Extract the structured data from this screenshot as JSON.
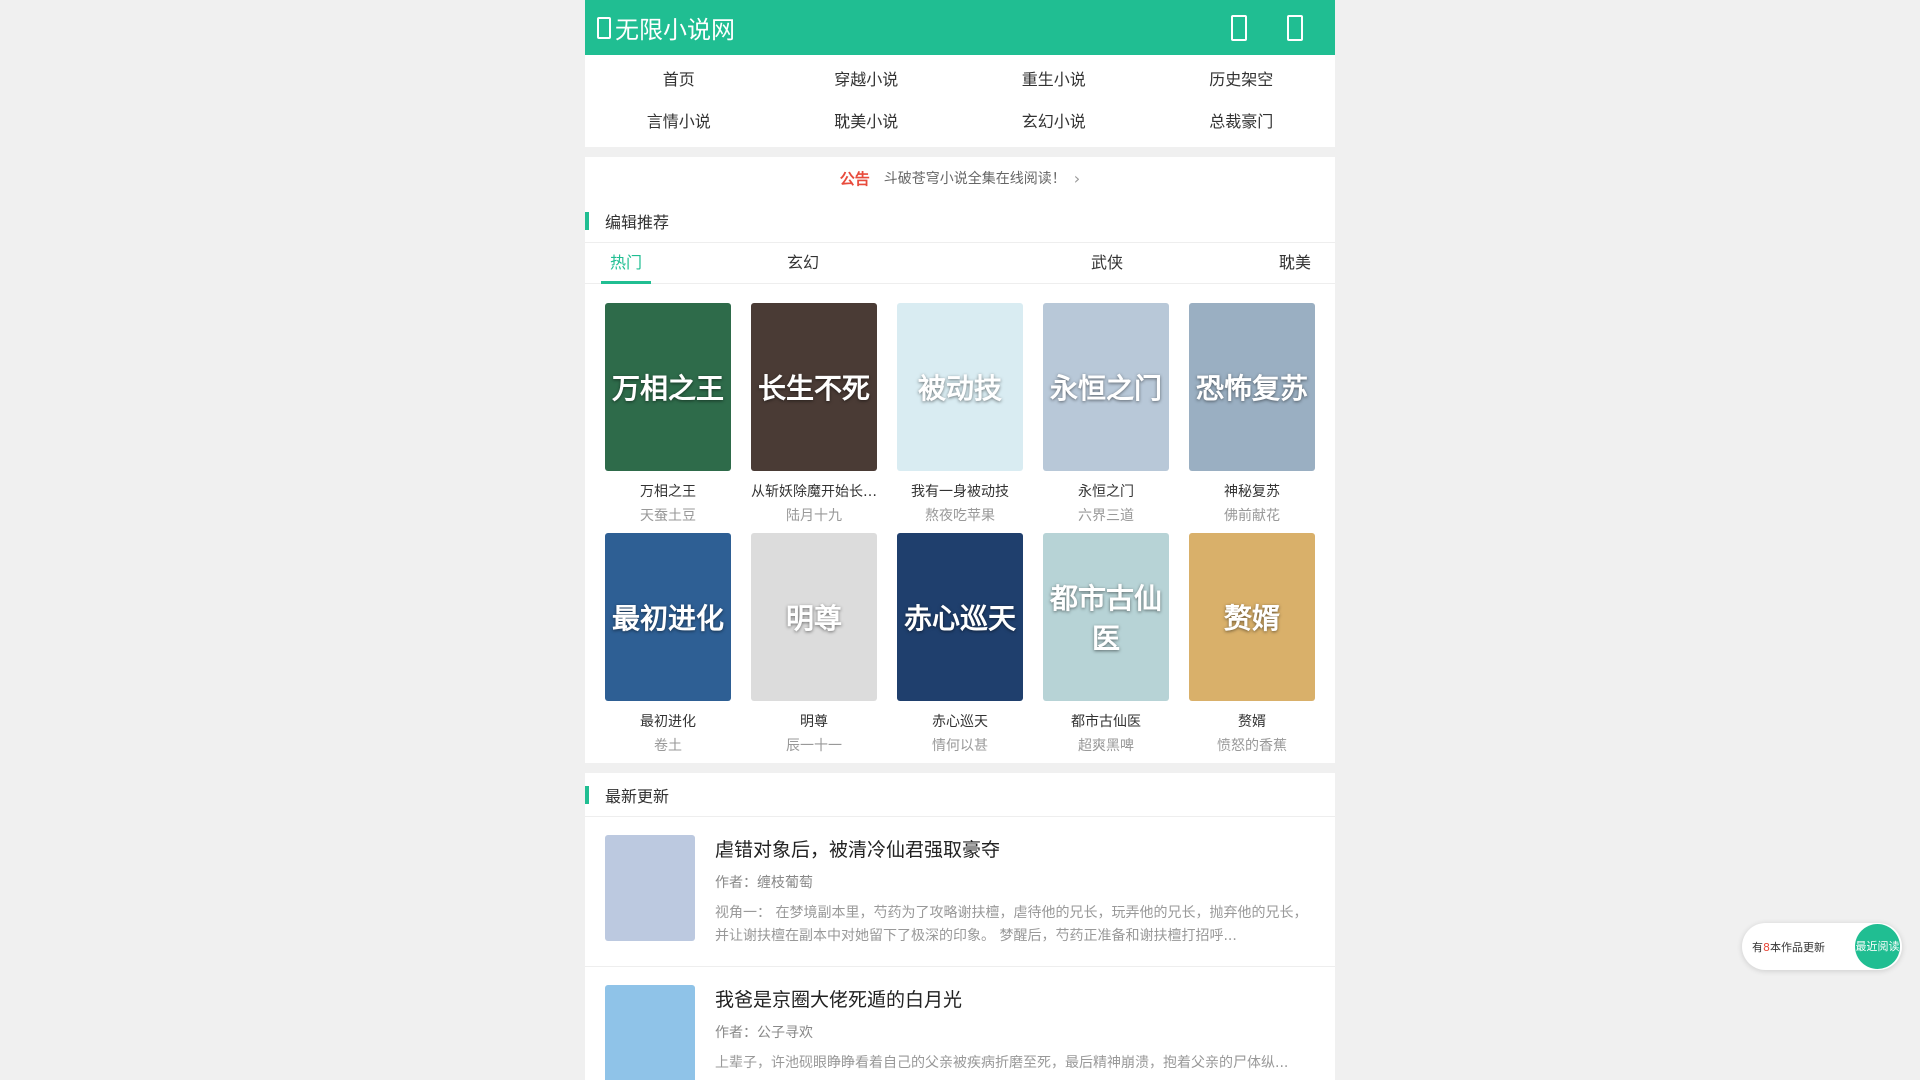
{
  "header": {
    "site_title": "无限小说网"
  },
  "nav": [
    "首页",
    "穿越小说",
    "重生小说",
    "历史架空",
    "言情小说",
    "耽美小说",
    "玄幻小说",
    "总裁豪门"
  ],
  "notice": {
    "tag": "公告",
    "text": "斗破苍穹小说全集在线阅读！"
  },
  "editor_picks": {
    "title": "编辑推荐",
    "tabs": [
      "热门",
      "玄幻",
      "武侠",
      "耽美"
    ],
    "books": [
      {
        "name": "万相之王",
        "author": "天蚕土豆",
        "cover_text": "万相之王",
        "color": "#2e6b4a"
      },
      {
        "name": "从斩妖除魔开始长生不死",
        "author": "陆月十九",
        "cover_text": "长生不死",
        "color": "#4a3b35"
      },
      {
        "name": "我有一身被动技",
        "author": "熬夜吃苹果",
        "cover_text": "被动技",
        "color": "#d9ecf2"
      },
      {
        "name": "永恒之门",
        "author": "六界三道",
        "cover_text": "永恒之门",
        "color": "#b8c8d8"
      },
      {
        "name": "神秘复苏",
        "author": "佛前献花",
        "cover_text": "恐怖复苏",
        "color": "#9aafc2"
      },
      {
        "name": "最初进化",
        "author": "卷土",
        "cover_text": "最初进化",
        "color": "#2e5f94"
      },
      {
        "name": "明尊",
        "author": "辰一十一",
        "cover_text": "明尊",
        "color": "#dcdcdc"
      },
      {
        "name": "赤心巡天",
        "author": "情何以甚",
        "cover_text": "赤心巡天",
        "color": "#1f3f6d"
      },
      {
        "name": "都市古仙医",
        "author": "超爽黑啤",
        "cover_text": "都市古仙医",
        "color": "#b7d3d6"
      },
      {
        "name": "赘婿",
        "author": "愤怒的香蕉",
        "cover_text": "赘婿",
        "color": "#d9b06a"
      }
    ]
  },
  "latest": {
    "title": "最新更新",
    "items": [
      {
        "title": "虐错对象后，被清冷仙君强取豪夺",
        "author": "作者：缠枝葡萄",
        "desc": "视角一： 在梦境副本里，芍药为了攻略谢扶檀，虐待他的兄长，玩弄他的兄长，抛弃他的兄长，并让谢扶檀在副本中对她留下了极深的印象。 梦醒后，芍药正准备和谢扶檀打招呼...",
        "color": "#bcc9e0"
      },
      {
        "title": "我爸是京圈大佬死遁的白月光",
        "author": "作者：公子寻欢",
        "desc": "上辈子，许池砚眼睁睁看着自己的父亲被疾病折磨至死，最后精神崩溃，抱着父亲的尸体纵...",
        "color": "#8fc3e8"
      }
    ]
  },
  "floater": {
    "prefix": "有",
    "count": "8",
    "suffix": "本作品更新",
    "button": "最近阅读"
  },
  "colors": {
    "accent": "#20be92",
    "notice_tag": "#e84b3c"
  }
}
